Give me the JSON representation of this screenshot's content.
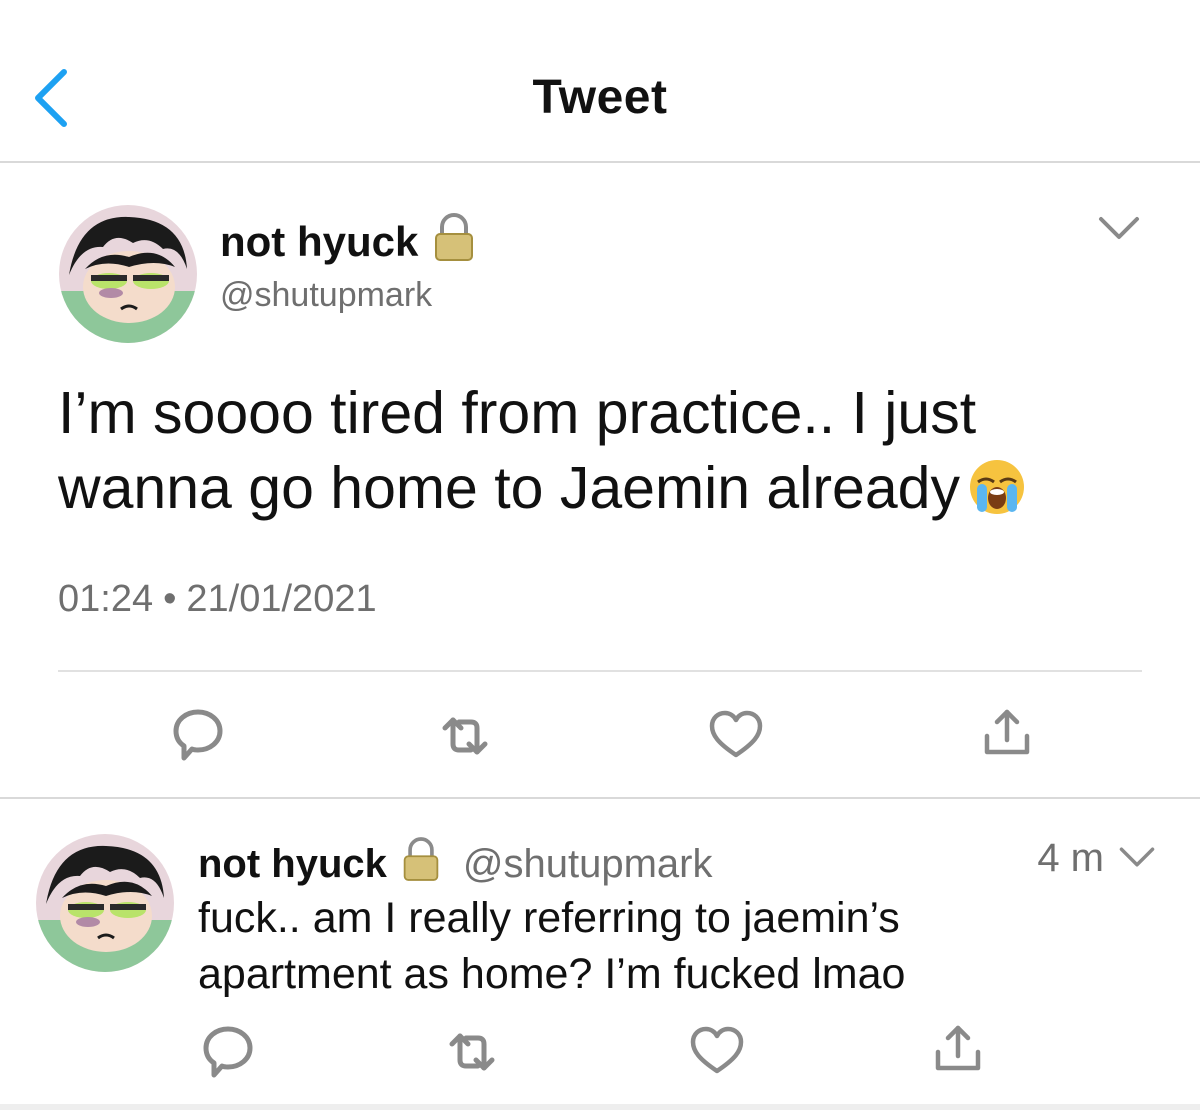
{
  "header": {
    "title": "Tweet"
  },
  "main_tweet": {
    "display_name": "not hyuck",
    "handle": "@shutupmark",
    "text_line1": "I’m soooo tired from practice.. I just",
    "text_line2": "wanna go home to Jaemin already",
    "time": "01:24",
    "separator": "•",
    "date": "21/01/2021"
  },
  "reply": {
    "display_name": "not hyuck",
    "handle": "@shutupmark",
    "time_ago": "4 m",
    "text_line1": "fuck.. am I really referring to jaemin’s",
    "text_line2": "apartment as home? I’m fucked lmao"
  },
  "icons": {
    "accent": "#1da1f2",
    "gray": "#8a8a8a",
    "lock": "lock-icon",
    "emoji": "loudly-crying-emoji"
  }
}
